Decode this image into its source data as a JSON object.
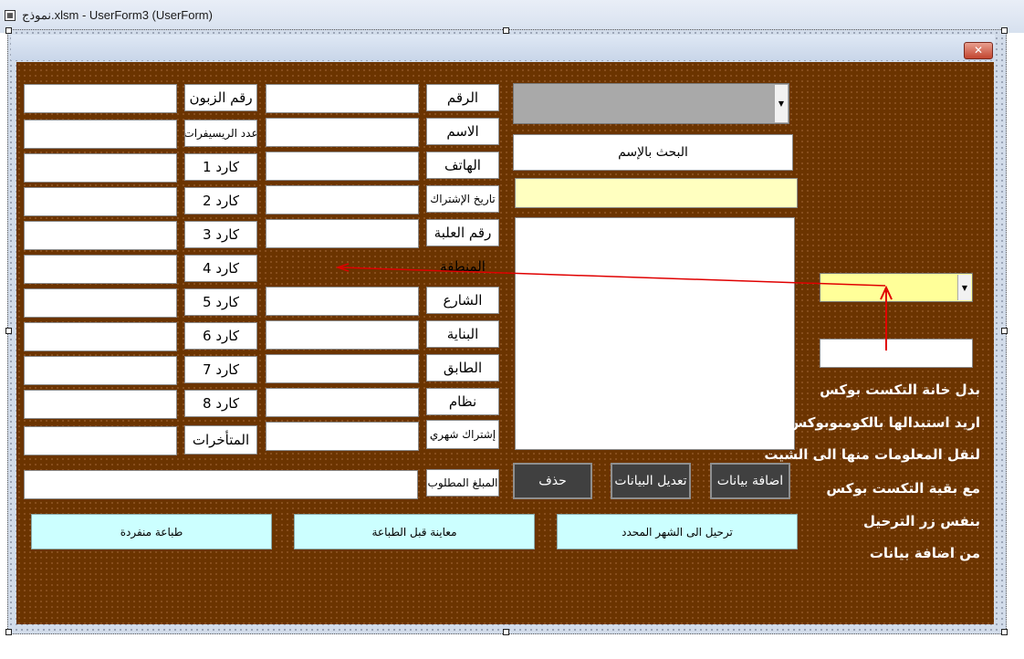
{
  "window": {
    "title": "نموذج.xlsm - UserForm3 (UserForm)",
    "close_symbol": "✕"
  },
  "fields_middle": {
    "number": "الرقم",
    "name": "الاسم",
    "phone": "الهاتف",
    "subscription_date": "تاريخ الإشتراك",
    "box_number": "رقم العلبة",
    "region": "المنطقة",
    "street": "الشارع",
    "building": "البناية",
    "floor": "الطابق",
    "system": "نظام",
    "monthly_subscription": "إشتراك شهري",
    "amount_due": "المبلغ المطلوب"
  },
  "fields_left": {
    "customer_number": "رقم الزبون",
    "receivers_count": "عدد الريسيفرات",
    "card1": "كارد 1",
    "card2": "كارد 2",
    "card3": "كارد 3",
    "card4": "كارد 4",
    "card5": "كارد 5",
    "card6": "كارد 6",
    "card7": "كارد 7",
    "card8": "كارد 8",
    "arrears": "المتأخرات"
  },
  "search": {
    "button_label": "البحث بالإسم",
    "combo_arrow": "▼"
  },
  "buttons": {
    "add_data": "اضافة بيانات",
    "edit_data": "تعديل البيانات",
    "delete": "حذف",
    "post_month": "ترحيل الى الشهر المحدد",
    "print_preview": "معاينة قبل الطباعة",
    "print_single": "طباعة منفردة"
  },
  "notes": [
    "بدل خانة التكست بوكس",
    "اريد استبدالها بالكومبوبوكس",
    "لنقل المعلومات منها الى الشيت",
    "مع بقية التكست بوكس",
    "بنفس زر الترحيل",
    "من اضافة بيانات"
  ],
  "colors": {
    "form_background": "#6b3400",
    "yellow_field": "#ffffc0",
    "combo_yellow": "#ffff99",
    "cyan_button": "#ccffff",
    "dark_button": "#404040",
    "arrow": "#e00000"
  }
}
